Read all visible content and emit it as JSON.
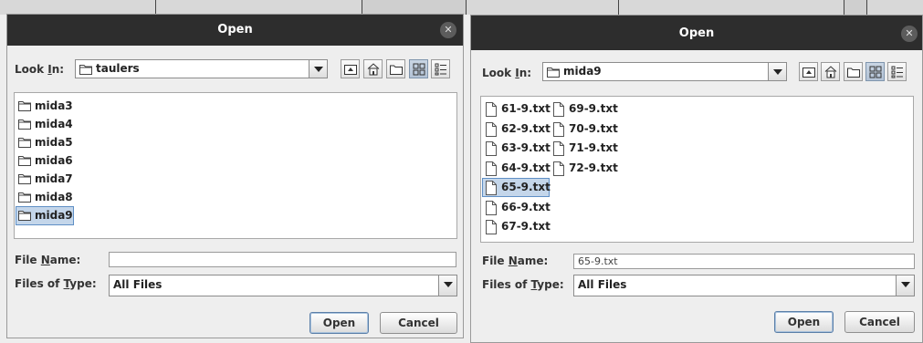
{
  "dialogs": [
    {
      "title": "Open",
      "look_in_label_pre": "Look ",
      "look_in_label_mn": "I",
      "look_in_label_post": "n:",
      "look_in_value": "taulers",
      "items": [
        "mida3",
        "mida4",
        "mida5",
        "mida6",
        "mida7",
        "mida8",
        "mida9"
      ],
      "selected_item": "mida9",
      "file_name_label_pre": "File ",
      "file_name_label_mn": "N",
      "file_name_label_post": "ame:",
      "file_name_value": "",
      "files_of_type_label_pre": "Files of ",
      "files_of_type_label_mn": "T",
      "files_of_type_label_post": "ype:",
      "files_of_type_value": "All Files",
      "open_label": "Open",
      "cancel_label": "Cancel"
    },
    {
      "title": "Open",
      "look_in_label_pre": "Look ",
      "look_in_label_mn": "I",
      "look_in_label_post": "n:",
      "look_in_value": "mida9",
      "items": [
        "61-9.txt",
        "62-9.txt",
        "63-9.txt",
        "64-9.txt",
        "65-9.txt",
        "66-9.txt",
        "67-9.txt",
        "69-9.txt",
        "70-9.txt",
        "71-9.txt",
        "72-9.txt"
      ],
      "selected_item": "65-9.txt",
      "file_name_label_pre": "File ",
      "file_name_label_mn": "N",
      "file_name_label_post": "ame:",
      "file_name_value": "65-9.txt",
      "files_of_type_label_pre": "Files of ",
      "files_of_type_label_mn": "T",
      "files_of_type_label_post": "ype:",
      "files_of_type_value": "All Files",
      "open_label": "Open",
      "cancel_label": "Cancel"
    }
  ],
  "icons": {
    "close": "close-icon",
    "folder": "folder-icon",
    "file": "file-icon",
    "up_folder": "up-one-level-icon",
    "home": "home-icon",
    "new_folder": "new-folder-icon",
    "list_view": "list-view-icon",
    "details_view": "details-view-icon"
  },
  "colors": {
    "titlebar": "#2d2d2d",
    "selection": "#c4d6ea",
    "selection_border": "#5f8fc5"
  }
}
